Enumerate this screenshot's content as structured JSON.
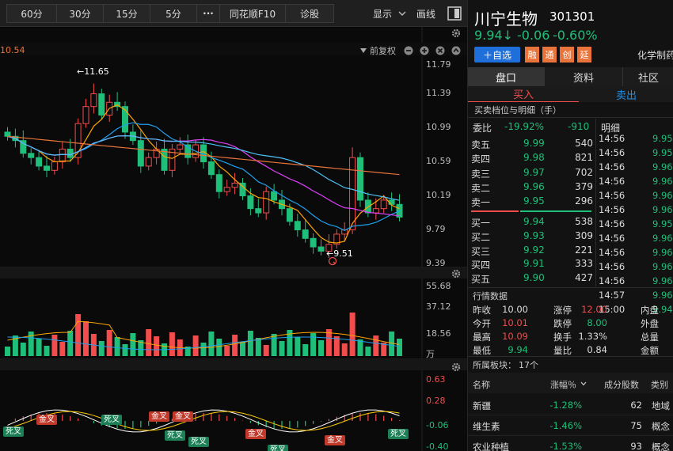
{
  "toolbar": {
    "tabs": [
      "60分",
      "30分",
      "15分",
      "5分"
    ],
    "more_icon": "ellipsis-icon",
    "buttons": [
      "同花顺F10",
      "诊股"
    ],
    "display_label": "显示",
    "draw_label": "画线"
  },
  "chart": {
    "ma_label": "10.54",
    "fuquan_label": "前复权",
    "price_axis": [
      "11.79",
      "11.39",
      "10.99",
      "10.59",
      "10.19",
      "9.79",
      "9.39"
    ],
    "high_annotation": "←11.65",
    "low_annotation": "←9.51",
    "volume_axis": [
      "55.68",
      "37.12",
      "18.56",
      "万"
    ],
    "macd_axis": [
      "0.63",
      "0.28",
      "-0.06",
      "-0.40"
    ],
    "cross_labels": [
      {
        "text": "死叉",
        "kind": "dead"
      },
      {
        "text": "金叉",
        "kind": "golden"
      },
      {
        "text": "死叉",
        "kind": "dead"
      },
      {
        "text": "金叉",
        "kind": "golden"
      },
      {
        "text": "死叉",
        "kind": "dead"
      },
      {
        "text": "金叉",
        "kind": "golden"
      },
      {
        "text": "死叉",
        "kind": "dead"
      },
      {
        "text": "金叉",
        "kind": "golden"
      },
      {
        "text": "死叉",
        "kind": "dead"
      },
      {
        "text": "金叉",
        "kind": "golden"
      },
      {
        "text": "死叉",
        "kind": "dead"
      }
    ]
  },
  "colors": {
    "up": "#f24c4c",
    "down": "#1fbf7a",
    "accent": "#1e6fd9",
    "tag": "#e8743b"
  },
  "stock": {
    "name": "川宁生物",
    "code": "301301",
    "price": "9.94↓",
    "change": "-0.06",
    "change_pct": "-0.60%",
    "add_watch": "＋自选",
    "tags": [
      "融",
      "通",
      "创",
      "延"
    ],
    "industry": "化学制药"
  },
  "tabs": [
    "盘口",
    "资料",
    "社区"
  ],
  "trade": {
    "buy": "买入",
    "sell": "卖出"
  },
  "orderbook": {
    "title": "买卖档位与明细（手）",
    "ratio_label": "委比",
    "ratio_pct": "-19.92%",
    "ratio_diff": "-910",
    "detail_label": "明细",
    "asks": [
      {
        "label": "卖五",
        "price": "9.99",
        "vol": "540"
      },
      {
        "label": "卖四",
        "price": "9.98",
        "vol": "821"
      },
      {
        "label": "卖三",
        "price": "9.97",
        "vol": "702"
      },
      {
        "label": "卖二",
        "price": "9.96",
        "vol": "379"
      },
      {
        "label": "卖一",
        "price": "9.95",
        "vol": "296"
      }
    ],
    "bids": [
      {
        "label": "买一",
        "price": "9.94",
        "vol": "538"
      },
      {
        "label": "买二",
        "price": "9.93",
        "vol": "309"
      },
      {
        "label": "买三",
        "price": "9.92",
        "vol": "221"
      },
      {
        "label": "买四",
        "price": "9.91",
        "vol": "333"
      },
      {
        "label": "买五",
        "price": "9.90",
        "vol": "427"
      }
    ],
    "ticks": [
      {
        "time": "14:56",
        "price": "9.95"
      },
      {
        "time": "14:56",
        "price": "9.95"
      },
      {
        "time": "14:56",
        "price": "9.96"
      },
      {
        "time": "14:56",
        "price": "9.96"
      },
      {
        "time": "14:56",
        "price": "9.96"
      },
      {
        "time": "14:56",
        "price": "9.96"
      },
      {
        "time": "14:56",
        "price": "9.95"
      },
      {
        "time": "14:56",
        "price": "9.96"
      },
      {
        "time": "14:56",
        "price": "9.96"
      },
      {
        "time": "14:56",
        "price": "9.96"
      },
      {
        "time": "14:56",
        "price": "9.96"
      },
      {
        "time": "14:57",
        "price": "9.96"
      },
      {
        "time": "15:00",
        "price": "9.94"
      }
    ]
  },
  "market": {
    "title": "行情数据",
    "rows": [
      [
        {
          "k": "昨收",
          "v": "10.00",
          "c": "w"
        },
        {
          "k": "涨停",
          "v": "12.00",
          "c": "r"
        },
        {
          "k": "内盘",
          "v": "",
          "c": "w"
        }
      ],
      [
        {
          "k": "今开",
          "v": "10.01",
          "c": "r"
        },
        {
          "k": "跌停",
          "v": "8.00",
          "c": "g"
        },
        {
          "k": "外盘",
          "v": "",
          "c": "w"
        }
      ],
      [
        {
          "k": "最高",
          "v": "10.09",
          "c": "r"
        },
        {
          "k": "换手",
          "v": "1.33%",
          "c": "w"
        },
        {
          "k": "总量",
          "v": "",
          "c": "w"
        }
      ],
      [
        {
          "k": "最低",
          "v": "9.94",
          "c": "g"
        },
        {
          "k": "量比",
          "v": "0.84",
          "c": "w"
        },
        {
          "k": "金额",
          "v": "",
          "c": "w"
        }
      ]
    ]
  },
  "sectors": {
    "title": "所属板块：",
    "count": "17个",
    "headers": {
      "name": "名称",
      "pct": "涨幅％",
      "count": "成分股数",
      "type": "类别"
    },
    "rows": [
      {
        "name": "新疆",
        "pct": "-1.28%",
        "count": "62",
        "type": "地域"
      },
      {
        "name": "维生素",
        "pct": "-1.46%",
        "count": "75",
        "type": "概念"
      },
      {
        "name": "农业种植",
        "pct": "-1.53%",
        "count": "93",
        "type": "概念"
      }
    ]
  }
}
